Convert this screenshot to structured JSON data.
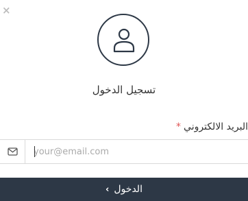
{
  "dialog": {
    "close_icon": "close-icon",
    "close_glyph": "×",
    "avatar_icon": "user-icon",
    "title": "تسجيل الدخول"
  },
  "form": {
    "email_label": "البريد الالكتروني",
    "required_mark": "*",
    "email_placeholder": "your@email.com",
    "email_value": "",
    "email_icon": "envelope-icon"
  },
  "submit": {
    "label": "الدخول",
    "chevron_glyph": "‹",
    "chevron_icon": "chevron-left-icon"
  },
  "colors": {
    "dark": "#2d3846",
    "required": "#e05555",
    "border": "#d9d9d9"
  }
}
